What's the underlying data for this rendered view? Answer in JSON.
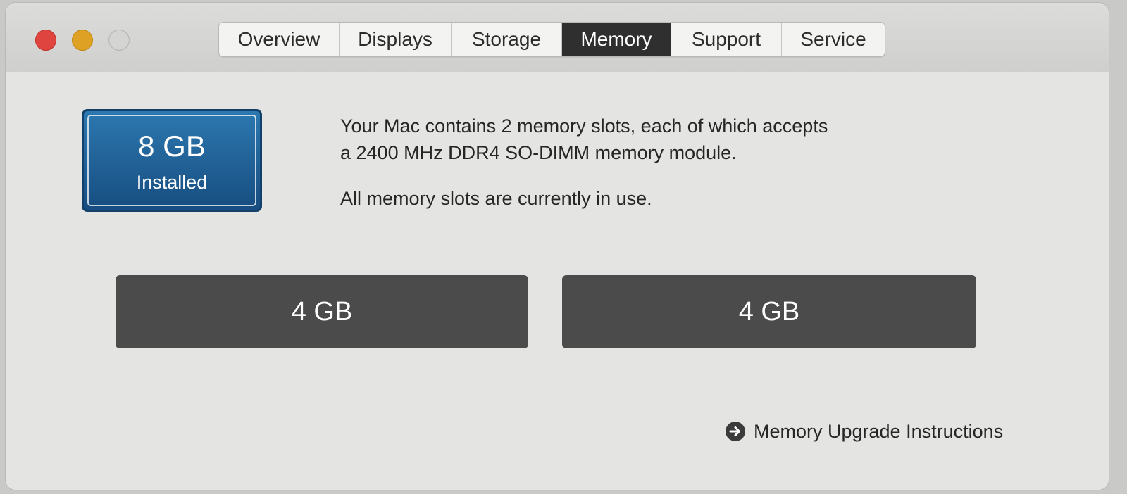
{
  "window": {
    "tabs": [
      {
        "label": "Overview",
        "selected": false
      },
      {
        "label": "Displays",
        "selected": false
      },
      {
        "label": "Storage",
        "selected": false
      },
      {
        "label": "Memory",
        "selected": true
      },
      {
        "label": "Support",
        "selected": false
      },
      {
        "label": "Service",
        "selected": false
      }
    ]
  },
  "memory": {
    "installed_amount": "8 GB",
    "installed_label": "Installed",
    "description_line1": "Your Mac contains 2 memory slots, each of which accepts",
    "description_line2": "a 2400 MHz DDR4 SO-DIMM memory module.",
    "status": "All memory slots are currently in use.",
    "slots": [
      {
        "size": "4 GB"
      },
      {
        "size": "4 GB"
      }
    ],
    "upgrade_link": "Memory Upgrade Instructions"
  },
  "colors": {
    "selected_tab": "#2f2f2f",
    "installed_badge": "#1f5f96",
    "slot": "#4b4b4b",
    "close": "#e0443e",
    "minimize": "#dea123",
    "zoom_disabled": "#d4d4d2"
  },
  "icons": {
    "link_icon": "right-arrow-circle-icon"
  }
}
